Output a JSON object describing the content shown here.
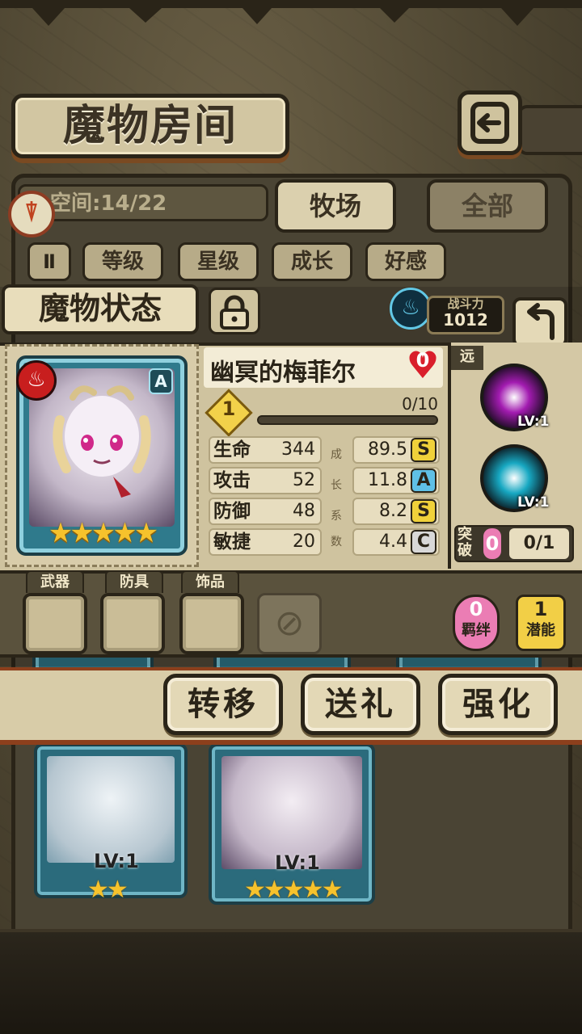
{
  "header": {
    "title": "魔物房间"
  },
  "room": {
    "space_text": "空间:14/22",
    "tabs": [
      {
        "label": "牧场"
      },
      {
        "label": "全部"
      }
    ],
    "filters": [
      {
        "label": "等级"
      },
      {
        "label": "星级"
      },
      {
        "label": "成长"
      },
      {
        "label": "好感"
      }
    ],
    "sort_glyph": "Ⅱ",
    "cards": [
      {
        "level": "LV:1",
        "stars": "★★"
      },
      {
        "level": "LV:1",
        "stars": "★★★★★"
      }
    ]
  },
  "status": {
    "title": "魔物状态",
    "power_label": "战斗力",
    "power_value": "1012",
    "range": "远",
    "rank": "A",
    "element_glyph": "♨",
    "monster": {
      "name": "幽冥的梅菲尔",
      "affection": "0",
      "level": "1",
      "exp": "0/10",
      "exp_fraction": 0.0,
      "stars": "★★★★★"
    },
    "growth_label_chars": [
      "成",
      "长",
      "系",
      "数"
    ],
    "stats": [
      {
        "label": "生命",
        "value": "344",
        "growth": "89.5",
        "grade": "S",
        "grade_color": "#f0d13a"
      },
      {
        "label": "攻击",
        "value": "52",
        "growth": "11.8",
        "grade": "A",
        "grade_color": "#5fc0e6"
      },
      {
        "label": "防御",
        "value": "48",
        "growth": "8.2",
        "grade": "S",
        "grade_color": "#f0d13a"
      },
      {
        "label": "敏捷",
        "value": "20",
        "growth": "4.4",
        "grade": "C",
        "grade_color": "#d8d8d8"
      }
    ],
    "skills": [
      {
        "level": "LV:1",
        "color": "#a21bb0"
      },
      {
        "level": "LV:1",
        "color": "#17a8c2"
      }
    ],
    "breakthrough": {
      "label": "突破",
      "count": "0",
      "progress": "0/1"
    },
    "equipment": [
      {
        "label": "武器"
      },
      {
        "label": "防具"
      },
      {
        "label": "饰品"
      }
    ],
    "bond": {
      "count": "0",
      "label": "羁绊"
    },
    "potential": {
      "count": "1",
      "label": "潜能"
    }
  },
  "actions": [
    {
      "label": "转移"
    },
    {
      "label": "送礼"
    },
    {
      "label": "强化"
    }
  ]
}
